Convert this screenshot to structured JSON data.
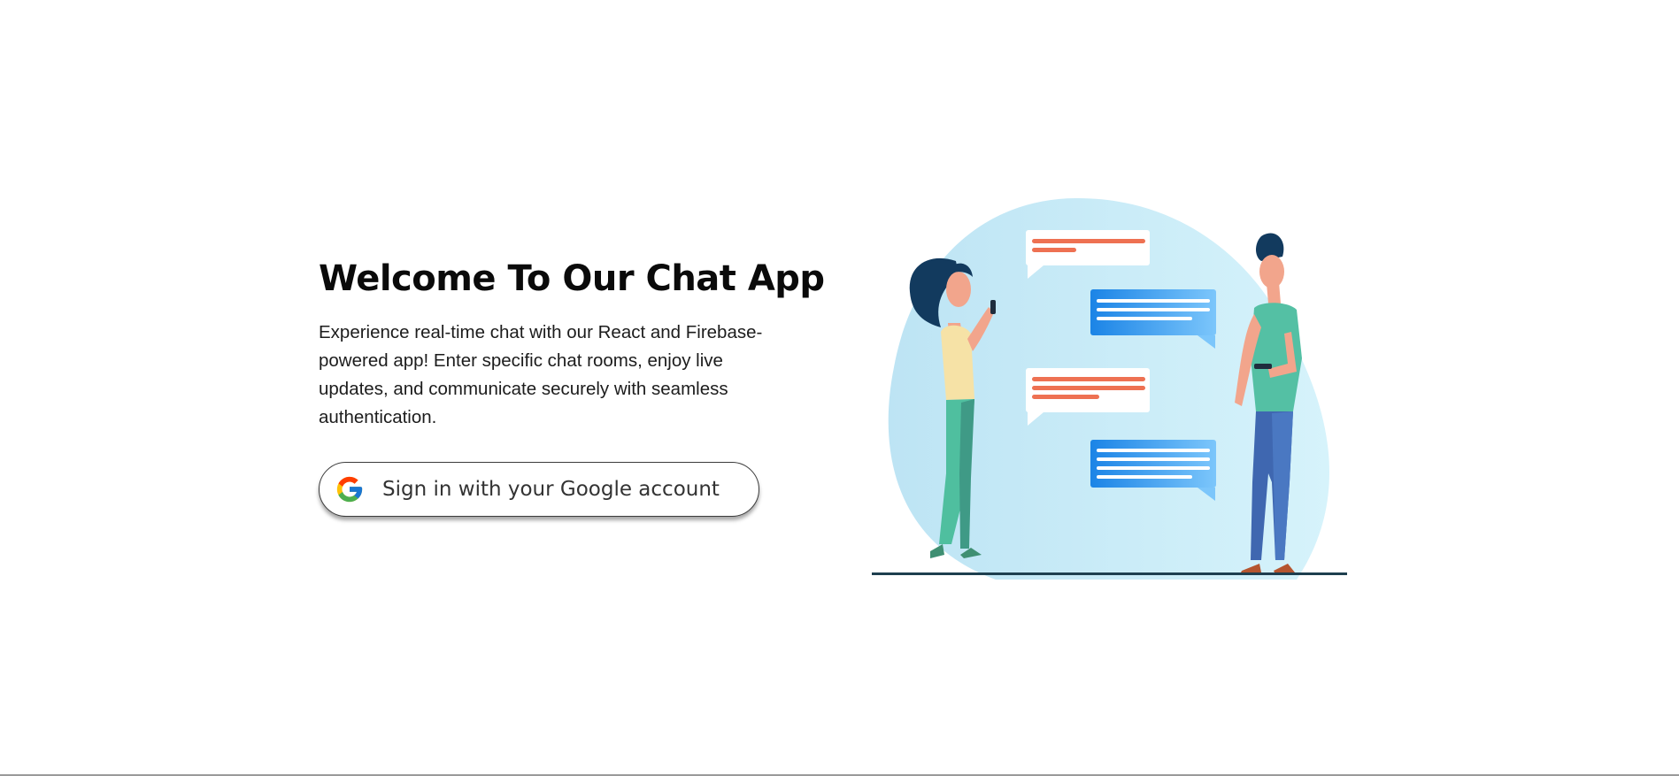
{
  "hero": {
    "title": "Welcome To Our Chat App",
    "description": "Experience real-time chat with our React and Firebase-powered app! Enter specific chat rooms, enjoy live updates, and communicate securely with seamless authentication.",
    "sign_in_label": "Sign in with your Google account",
    "sign_in_icon": "google-icon"
  },
  "illustration": {
    "name": "chat-illustration"
  },
  "colors": {
    "text_primary": "#0a0a0a",
    "button_border": "#3b3b3b",
    "blob": "#c2e8f6",
    "bubble_blue": "#1f8fe8",
    "bubble_line_orange": "#ee7152",
    "woman_shirt": "#f6e2a6",
    "woman_pants": "#4fbf9f",
    "man_shirt": "#54c0a4",
    "man_pants": "#3f67b0",
    "hair": "#123a5e",
    "ground": "#1e3f4f"
  }
}
